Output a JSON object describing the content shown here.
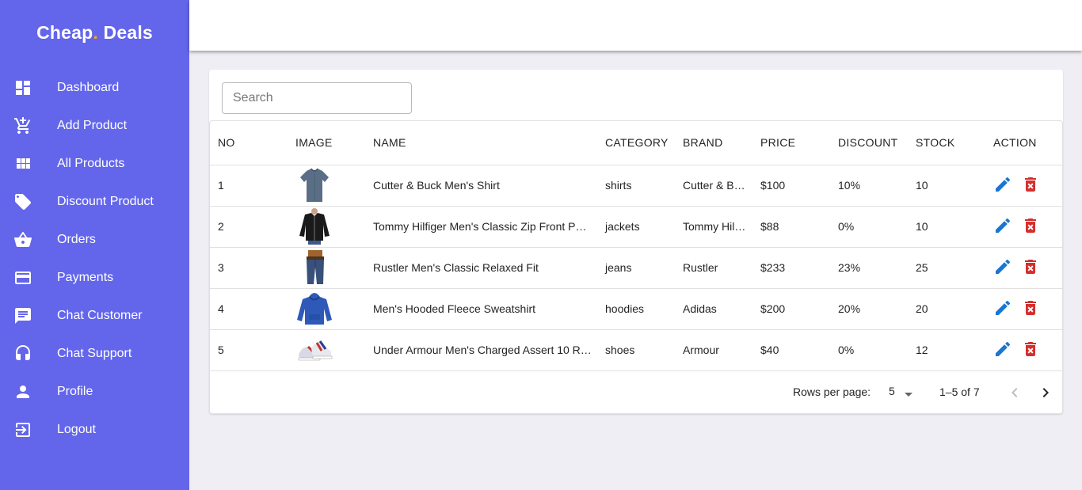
{
  "brand": {
    "part1": "Cheap",
    "dot": ".",
    "part2": " Deals"
  },
  "nav": [
    {
      "label": "Dashboard",
      "icon": "dashboard-icon"
    },
    {
      "label": "Add Product",
      "icon": "add-cart-icon"
    },
    {
      "label": "All Products",
      "icon": "grid-icon"
    },
    {
      "label": "Discount Product",
      "icon": "tag-icon"
    },
    {
      "label": "Orders",
      "icon": "basket-icon"
    },
    {
      "label": "Payments",
      "icon": "credit-card-icon"
    },
    {
      "label": "Chat Customer",
      "icon": "chat-icon"
    },
    {
      "label": "Chat Support",
      "icon": "headset-icon"
    },
    {
      "label": "Profile",
      "icon": "person-icon"
    },
    {
      "label": "Logout",
      "icon": "logout-icon"
    }
  ],
  "search": {
    "placeholder": "Search",
    "value": ""
  },
  "table": {
    "headers": [
      "NO",
      "IMAGE",
      "NAME",
      "CATEGORY",
      "BRAND",
      "PRICE",
      "DISCOUNT",
      "STOCK",
      "ACTION"
    ],
    "rows": [
      {
        "no": "1",
        "image": "shirt-image",
        "name": "Cutter & Buck Men's Shirt",
        "category": "shirts",
        "brand": "Cutter & B…",
        "price": "$100",
        "discount": "10%",
        "stock": "10"
      },
      {
        "no": "2",
        "image": "jacket-image",
        "name": "Tommy Hilfiger Men's Classic Zip Front P…",
        "category": "jackets",
        "brand": "Tommy Hil…",
        "price": "$88",
        "discount": "0%",
        "stock": "10"
      },
      {
        "no": "3",
        "image": "jeans-image",
        "name": "Rustler Men's Classic Relaxed Fit",
        "category": "jeans",
        "brand": "Rustler",
        "price": "$233",
        "discount": "23%",
        "stock": "25"
      },
      {
        "no": "4",
        "image": "hoodie-image",
        "name": "Men's Hooded Fleece Sweatshirt",
        "category": "hoodies",
        "brand": "Adidas",
        "price": "$200",
        "discount": "20%",
        "stock": "20"
      },
      {
        "no": "5",
        "image": "shoes-image",
        "name": "Under Armour Men's Charged Assert 10 R…",
        "category": "shoes",
        "brand": "Armour",
        "price": "$40",
        "discount": "0%",
        "stock": "12"
      }
    ],
    "edit_icon": "pencil-icon",
    "delete_icon": "trash-icon"
  },
  "pagination": {
    "rows_per_page_label": "Rows per page:",
    "rows_per_page": "5",
    "range": "1–5 of 7"
  },
  "colors": {
    "sidebar": "#6366ea",
    "brand_dot": "#f7a13a",
    "edit": "#1976d2",
    "delete": "#d32f2f"
  }
}
